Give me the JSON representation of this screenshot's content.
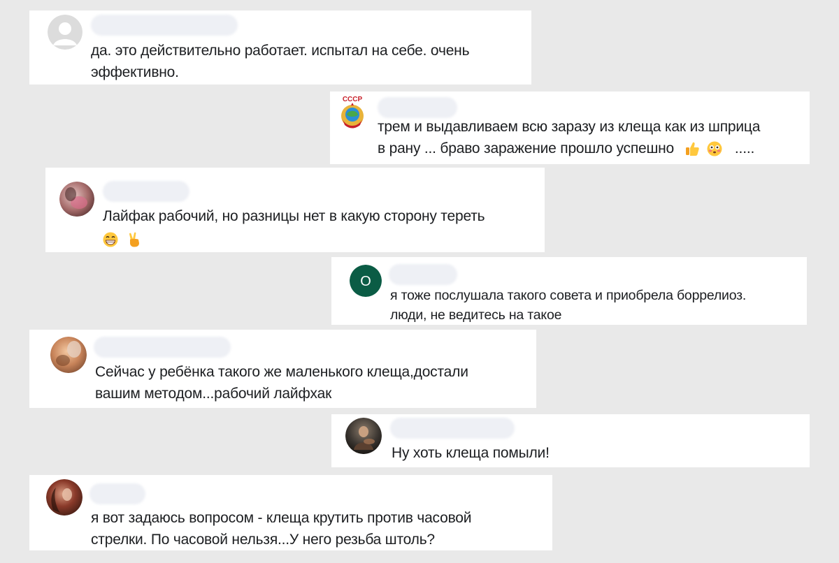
{
  "comments": [
    {
      "avatar": "default-user-avatar",
      "line1": "да. это действительно работает. испытал на себе. очень",
      "line2": "эффективно."
    },
    {
      "avatar": "ussr-emblem-avatar",
      "avatar_text": "СССР",
      "line1": "трем и выдавливаем всю заразу из клеща как из шприца",
      "line2": "в рану ... браво заражение прошло успешно",
      "line2_suffix": ".....",
      "emojis": [
        "thumbs-up-emoji",
        "flushed-face-emoji"
      ]
    },
    {
      "avatar": "photo-avatar",
      "line1": "Лайфак рабочий, но разницы нет в какую сторону тереть",
      "emojis": [
        "grinning-face-emoji",
        "victory-hand-emoji"
      ]
    },
    {
      "avatar": "letter-avatar",
      "avatar_letter": "О",
      "avatar_color": "#0b5c45",
      "line1": "я тоже послушала такого совета и приобрела боррелиоз.",
      "line2": "люди, не ведитесь на такое"
    },
    {
      "avatar": "photo-avatar",
      "line1": "Сейчас у ребёнка такого же маленького клеща,достали",
      "line2": "вашим методом...рабочий лайфхак"
    },
    {
      "avatar": "photo-avatar",
      "line1": "Ну хоть клеща помыли!"
    },
    {
      "avatar": "photo-avatar",
      "line1": "я вот задаюсь вопросом - клеща крутить против часовой",
      "line2": "стрелки. По часовой нельзя...У него резьба штоль?"
    }
  ]
}
